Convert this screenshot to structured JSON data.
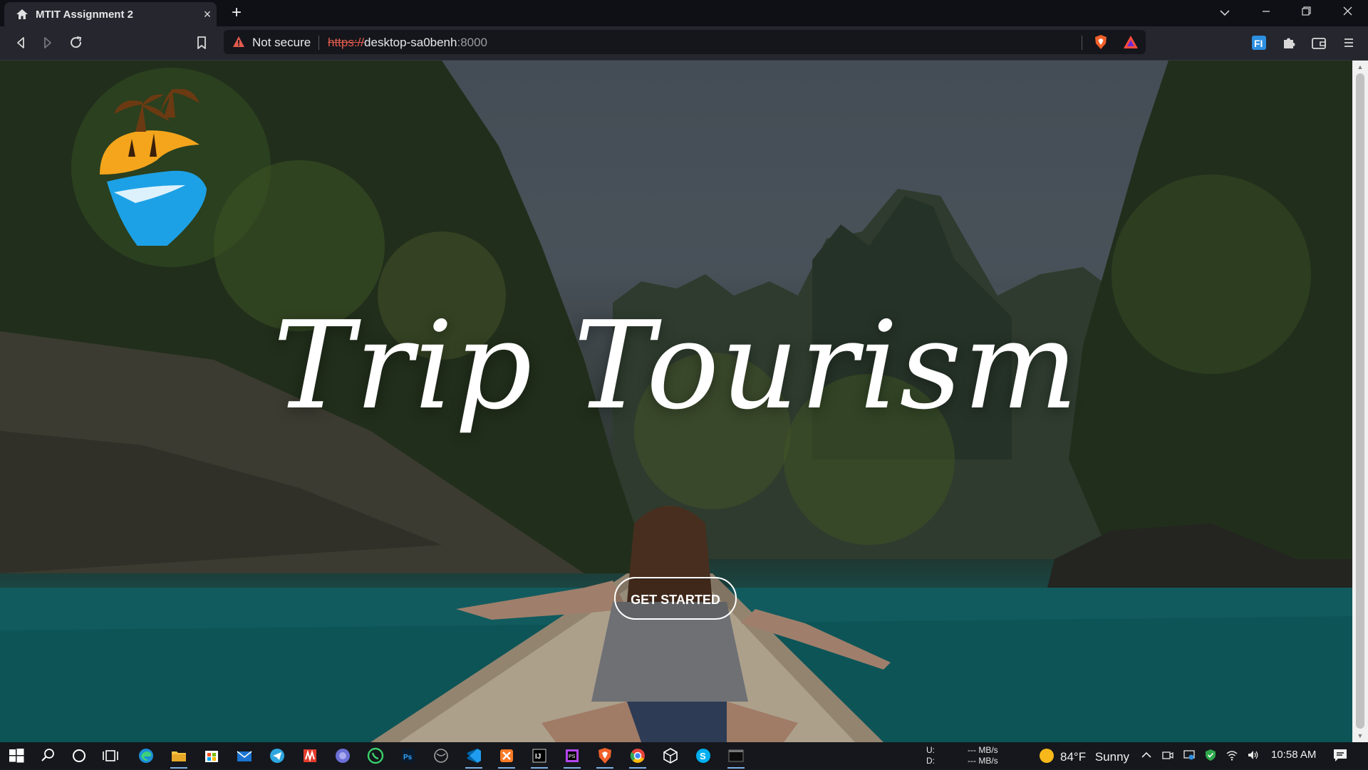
{
  "browser": {
    "tab_title": "MTIT Assignment 2",
    "new_tab": "+",
    "close_tab": "×",
    "not_secure": "Not secure",
    "url_protocol": "https://",
    "url_host": "desktop-sa0benh",
    "url_port": ":8000"
  },
  "page": {
    "hero_title": "Trip Tourism",
    "cta_label": "GET STARTED"
  },
  "taskbar": {
    "net_up_label": "U:",
    "net_down_label": "D:",
    "net_up_value": "--- MB/s",
    "net_down_value": "--- MB/s",
    "temperature": "84°F",
    "condition": "Sunny",
    "time": "10:58 AM"
  },
  "colors": {
    "accent_blue": "#1da1e6",
    "logo_orange": "#f4a51c",
    "logo_brown": "#6b3a12",
    "not_secure_red": "#e25b4d"
  }
}
